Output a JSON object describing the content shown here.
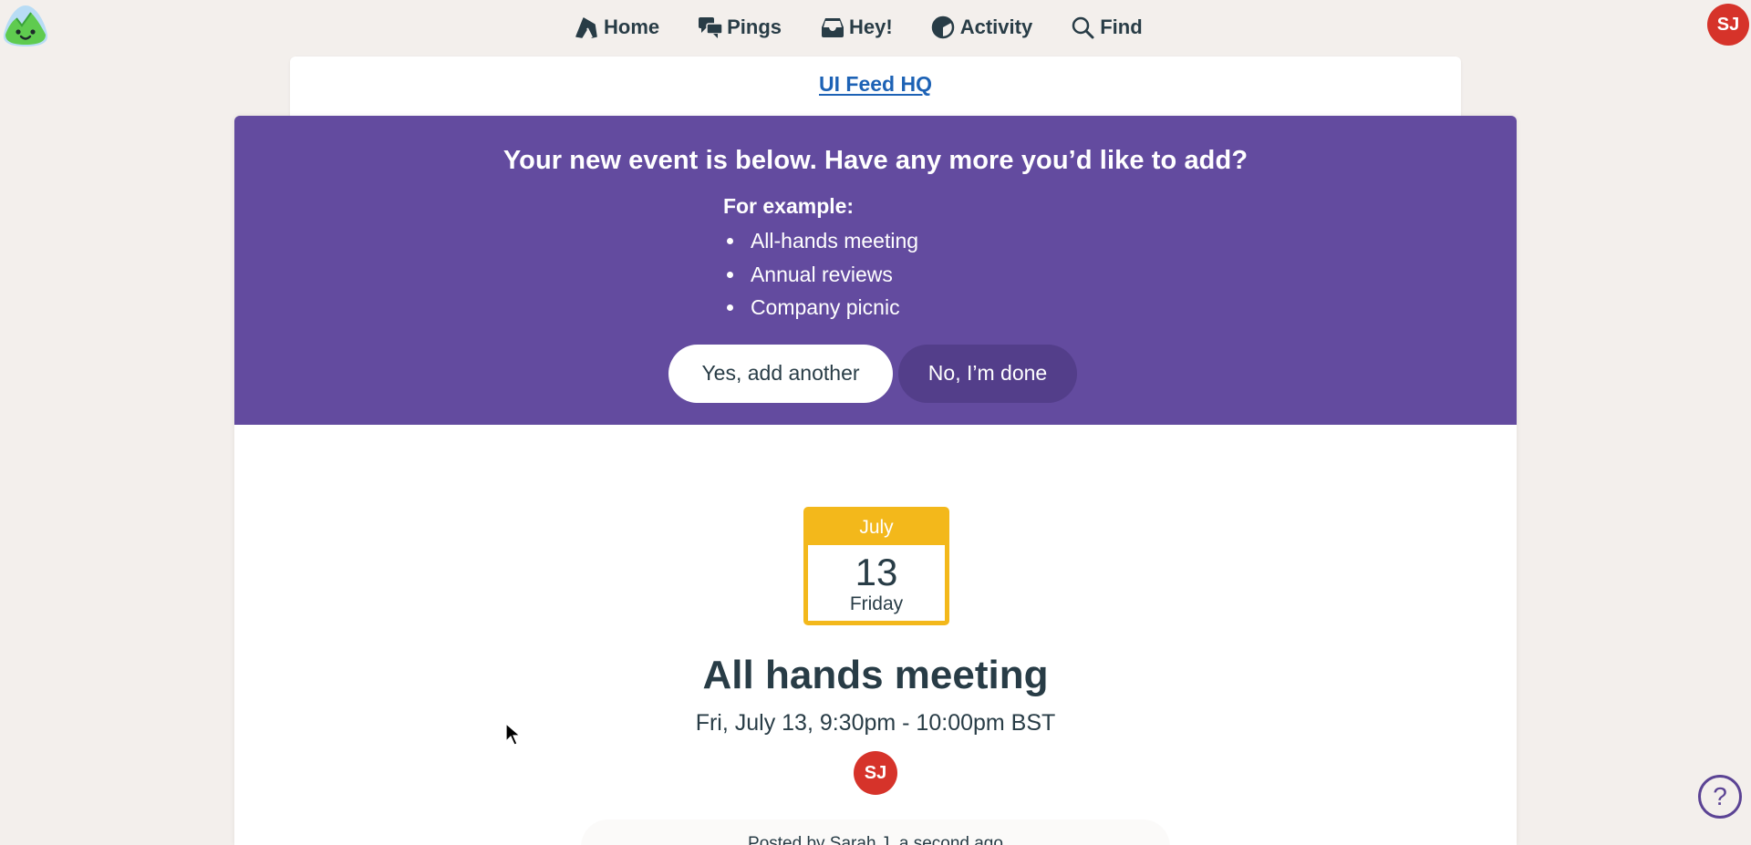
{
  "app": {
    "logo": "basecamp-logo-icon",
    "user_initials": "SJ",
    "avatar_color": "#d6332a"
  },
  "nav": {
    "items": [
      {
        "label": "Home",
        "icon": "home-icon"
      },
      {
        "label": "Pings",
        "icon": "pings-icon"
      },
      {
        "label": "Hey!",
        "icon": "inbox-icon"
      },
      {
        "label": "Activity",
        "icon": "activity-icon"
      },
      {
        "label": "Find",
        "icon": "search-icon"
      }
    ]
  },
  "project": {
    "name": "UI Feed HQ"
  },
  "banner": {
    "title": "Your new event is below. Have any more you’d like to add?",
    "examples_label": "For example:",
    "examples": [
      "All-hands meeting",
      "Annual reviews",
      "Company picnic"
    ],
    "yes_label": "Yes, add another",
    "no_label": "No, I’m done",
    "color": "#634b9f"
  },
  "event": {
    "month": "July",
    "day": "13",
    "weekday": "Friday",
    "title": "All hands meeting",
    "time": "Fri, July 13, 9:30pm - 10:00pm BST",
    "author_initials": "SJ",
    "posted_by": "Posted by Sarah J. a second ago",
    "calendar_color": "#f3b81b"
  },
  "help": {
    "label": "?"
  }
}
